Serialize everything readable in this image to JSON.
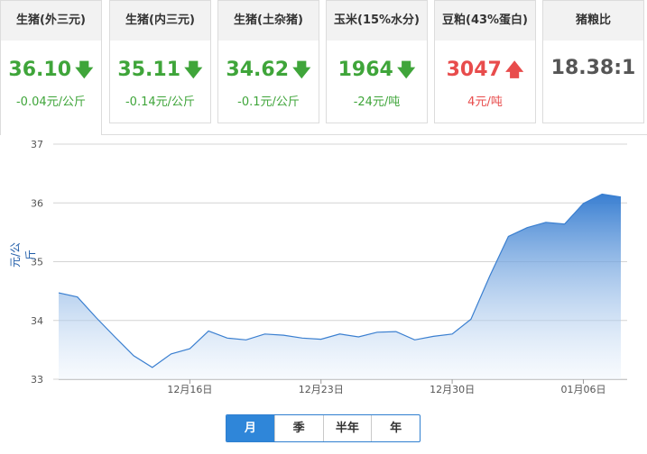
{
  "cards": [
    {
      "title": "生猪(外三元)",
      "price": "36.10",
      "change": "-0.04元/公斤",
      "dir": "down"
    },
    {
      "title": "生猪(内三元)",
      "price": "35.11",
      "change": "-0.14元/公斤",
      "dir": "down"
    },
    {
      "title": "生猪(土杂猪)",
      "price": "34.62",
      "change": "-0.1元/公斤",
      "dir": "down"
    },
    {
      "title": "玉米(15%水分)",
      "price": "1964",
      "change": "-24元/吨",
      "dir": "down"
    },
    {
      "title": "豆粕(43%蛋白)",
      "price": "3047",
      "change": "4元/吨",
      "dir": "up"
    },
    {
      "title": "猪粮比",
      "price": "18.38:1",
      "change": "",
      "dir": "none"
    }
  ],
  "icons": {
    "down": "arrow-down-icon",
    "up": "arrow-up-icon"
  },
  "colors": {
    "down": "#3fa53a",
    "up": "#e84c4c",
    "series": "#3a7fd0",
    "range_selected": "#2f86d9"
  },
  "range_buttons": [
    "月",
    "季",
    "半年",
    "年"
  ],
  "range_selected": "月",
  "chart_data": {
    "type": "area",
    "ylabel": "元/公斤",
    "ylim": [
      33,
      37
    ],
    "yticks": [
      "33",
      "34",
      "35",
      "36",
      "37"
    ],
    "xticks": [
      {
        "label": "12月16日",
        "index": 7
      },
      {
        "label": "12月23日",
        "index": 14
      },
      {
        "label": "12月30日",
        "index": 21
      },
      {
        "label": "01月06日",
        "index": 28
      }
    ],
    "grid": true,
    "series": [
      {
        "values": [
          34.47,
          34.4,
          34.05,
          33.72,
          33.4,
          33.2,
          33.43,
          33.52,
          33.82,
          33.7,
          33.67,
          33.77,
          33.75,
          33.7,
          33.68,
          33.77,
          33.72,
          33.8,
          33.81,
          33.67,
          33.73,
          33.77,
          34.02,
          34.75,
          35.43,
          35.58,
          35.67,
          35.64,
          35.99,
          36.15,
          36.1
        ]
      }
    ]
  }
}
